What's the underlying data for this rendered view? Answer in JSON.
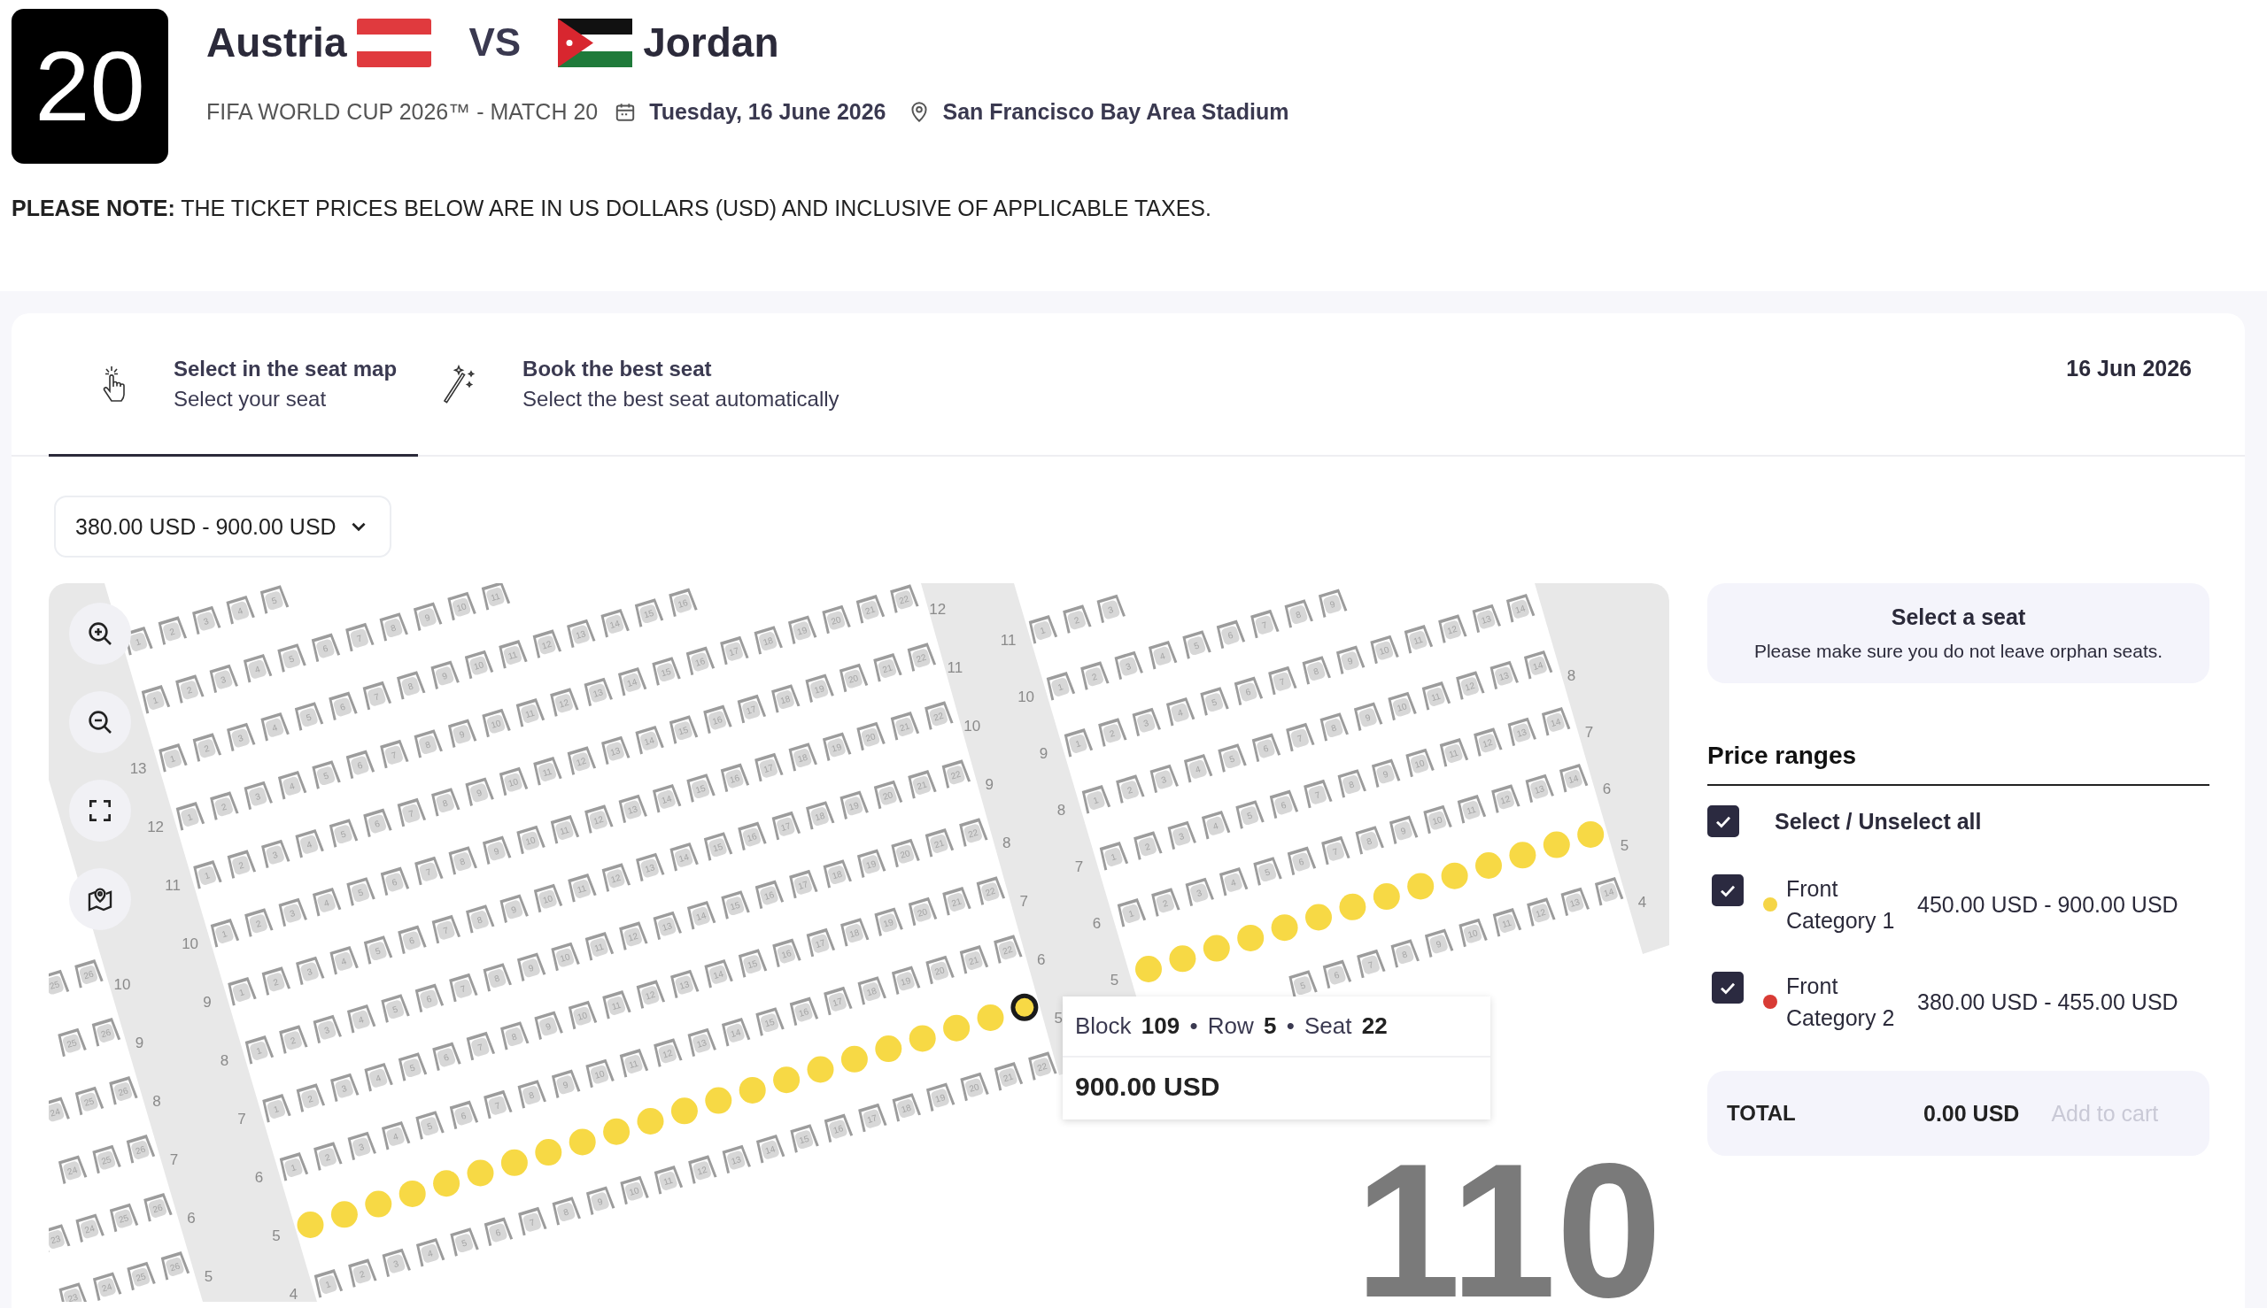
{
  "match": {
    "number": "20",
    "home": "Austria",
    "vs": "VS",
    "away": "Jordan",
    "competition": "FIFA WORLD CUP 2026™ - MATCH 20",
    "date": "Tuesday, 16 June 2026",
    "venue": "San Francisco Bay Area Stadium"
  },
  "notice": "**PLEASE NOTE:** THE TICKET PRICES BELOW ARE IN US DOLLARS (USD) AND INCLUSIVE OF APPLICABLE TAXES.",
  "tabs": [
    {
      "kind": "pointer",
      "title": "Select in the seat map",
      "subtitle": "Select your seat",
      "selected": true
    },
    {
      "kind": "wand",
      "title": "Book the best seat",
      "subtitle": "Select the best seat automatically",
      "selected": false
    }
  ],
  "date": "16 Jun 2026",
  "price_filter": "380.00 USD - 900.00 USD",
  "seat_map": {
    "blocks": [
      {
        "rows": [
          {
            "label_end": "5",
            "kind": "available",
            "cut_at_start": true,
            "seats": [
              "23",
              "24",
              "25",
              "26"
            ]
          },
          {
            "label_end": "6",
            "kind": "available",
            "cut_at_start": true,
            "seats": [
              "23",
              "24",
              "25",
              "26"
            ]
          },
          {
            "label_end": "7",
            "kind": "available",
            "cut_at_start": true,
            "seats": [
              "24",
              "25",
              "26"
            ]
          },
          {
            "label_end": "8",
            "kind": "available",
            "cut_at_start": true,
            "seats": [
              "24",
              "25",
              "26"
            ]
          },
          {
            "label_end": "9",
            "kind": "available",
            "cut_at_start": true,
            "seats": [
              "25",
              "26"
            ]
          },
          {
            "label_end": "10",
            "kind": "available",
            "cut_at_start": true,
            "seats": [
              "25",
              "26"
            ]
          }
        ]
      },
      {
        "rows": [
          {
            "label_start": "4",
            "kind": "available",
            "seats": [
              "1",
              "2",
              "3",
              "4",
              "5",
              "6",
              "7",
              "8",
              "9",
              "10",
              "11",
              "12",
              "13",
              "14",
              "15",
              "16",
              "17",
              "18",
              "19",
              "20",
              "21",
              "22"
            ]
          },
          {
            "label_start": "5",
            "label_end": "5",
            "kind": "priced",
            "color": "#f7d945",
            "seats": [
              {
                "hovered": false
              },
              {
                "hovered": false
              },
              {
                "hovered": false
              },
              {
                "hovered": false
              },
              {
                "hovered": false
              },
              {
                "hovered": false
              },
              {
                "hovered": false
              },
              {
                "hovered": false
              },
              {
                "hovered": false
              },
              {
                "hovered": false
              },
              {
                "hovered": false
              },
              {
                "hovered": false
              },
              {
                "hovered": false
              },
              {
                "hovered": false
              },
              {
                "hovered": false
              },
              {
                "hovered": false
              },
              {
                "hovered": false
              },
              {
                "hovered": false
              },
              {
                "hovered": false
              },
              {
                "hovered": false
              },
              {
                "hovered": false
              },
              {
                "hovered": true
              }
            ]
          },
          {
            "label_start": "6",
            "label_end": "6",
            "kind": "available",
            "seats": [
              "1",
              "2",
              "3",
              "4",
              "5",
              "6",
              "7",
              "8",
              "9",
              "10",
              "11",
              "12",
              "13",
              "14",
              "15",
              "16",
              "17",
              "18",
              "19",
              "20",
              "21",
              "22"
            ]
          },
          {
            "label_start": "7",
            "label_end": "7",
            "kind": "available",
            "seats": [
              "1",
              "2",
              "3",
              "4",
              "5",
              "6",
              "7",
              "8",
              "9",
              "10",
              "11",
              "12",
              "13",
              "14",
              "15",
              "16",
              "17",
              "18",
              "19",
              "20",
              "21",
              "22"
            ]
          },
          {
            "label_start": "8",
            "label_end": "8",
            "kind": "available",
            "seats": [
              "1",
              "2",
              "3",
              "4",
              "5",
              "6",
              "7",
              "8",
              "9",
              "10",
              "11",
              "12",
              "13",
              "14",
              "15",
              "16",
              "17",
              "18",
              "19",
              "20",
              "21",
              "22"
            ]
          },
          {
            "label_start": "9",
            "label_end": "9",
            "kind": "available",
            "seats": [
              "1",
              "2",
              "3",
              "4",
              "5",
              "6",
              "7",
              "8",
              "9",
              "10",
              "11",
              "12",
              "13",
              "14",
              "15",
              "16",
              "17",
              "18",
              "19",
              "20",
              "21",
              "22"
            ]
          },
          {
            "label_start": "10",
            "label_end": "10",
            "kind": "available",
            "seats": [
              "1",
              "2",
              "3",
              "4",
              "5",
              "6",
              "7",
              "8",
              "9",
              "10",
              "11",
              "12",
              "13",
              "14",
              "15",
              "16",
              "17",
              "18",
              "19",
              "20",
              "21",
              "22"
            ]
          },
          {
            "label_start": "11",
            "label_end": "11",
            "kind": "available",
            "seats": [
              "1",
              "2",
              "3",
              "4",
              "5",
              "6",
              "7",
              "8",
              "9",
              "10",
              "11",
              "12",
              "13",
              "14",
              "15",
              "16",
              "17",
              "18",
              "19",
              "20",
              "21",
              "22"
            ]
          },
          {
            "label_start": "12",
            "label_end": "12",
            "kind": "available",
            "seats": [
              "1",
              "2",
              "3",
              "4",
              "5",
              "6",
              "7",
              "8",
              "9",
              "10",
              "11",
              "12",
              "13",
              "14",
              "15",
              "16",
              "17",
              "18",
              "19",
              "20",
              "21",
              "22"
            ]
          },
          {
            "label_start": "13",
            "kind": "available",
            "seats": [
              "1",
              "2",
              "3",
              "4",
              "5",
              "6",
              "7",
              "8",
              "9",
              "10",
              "11",
              "12",
              "13",
              "14",
              "15",
              "16"
            ]
          },
          {
            "kind": "available",
            "seats": [
              "1",
              "2",
              "3",
              "4",
              "5",
              "6",
              "7",
              "8",
              "9",
              "10",
              "11"
            ]
          },
          {
            "kind": "available",
            "seats": [
              "1",
              "2",
              "3",
              "4",
              "5"
            ]
          }
        ]
      },
      {
        "rows": [
          {
            "label_end": "4",
            "kind": "available",
            "cut_at_start": true,
            "seats": [
              "5",
              "6",
              "7",
              "8",
              "9",
              "10",
              "11",
              "12",
              "13",
              "14"
            ]
          },
          {
            "label_start": "5",
            "label_end": "5",
            "kind": "priced",
            "color": "#f7d945",
            "seats": [
              {
                "hovered": false
              },
              {
                "hovered": false
              },
              {
                "hovered": false
              },
              {
                "hovered": false
              },
              {
                "hovered": false
              },
              {
                "hovered": false
              },
              {
                "hovered": false
              },
              {
                "hovered": false
              },
              {
                "hovered": false
              },
              {
                "hovered": false
              },
              {
                "hovered": false
              },
              {
                "hovered": false
              },
              {
                "hovered": false
              },
              {
                "hovered": false
              }
            ]
          },
          {
            "label_start": "6",
            "label_end": "6",
            "kind": "available",
            "seats": [
              "1",
              "2",
              "3",
              "4",
              "5",
              "6",
              "7",
              "8",
              "9",
              "10",
              "11",
              "12",
              "13",
              "14"
            ]
          },
          {
            "label_start": "7",
            "label_end": "7",
            "kind": "available",
            "seats": [
              "1",
              "2",
              "3",
              "4",
              "5",
              "6",
              "7",
              "8",
              "9",
              "10",
              "11",
              "12",
              "13",
              "14"
            ]
          },
          {
            "label_start": "8",
            "label_end": "8",
            "kind": "available",
            "seats": [
              "1",
              "2",
              "3",
              "4",
              "5",
              "6",
              "7",
              "8",
              "9",
              "10",
              "11",
              "12",
              "13",
              "14"
            ]
          },
          {
            "label_start": "9",
            "kind": "available",
            "seats": [
              "1",
              "2",
              "3",
              "4",
              "5",
              "6",
              "7",
              "8",
              "9",
              "10",
              "11",
              "12",
              "13",
              "14"
            ]
          },
          {
            "label_start": "10",
            "kind": "available",
            "seats": [
              "1",
              "2",
              "3",
              "4",
              "5",
              "6",
              "7",
              "8",
              "9"
            ]
          },
          {
            "label_start": "11",
            "kind": "available",
            "seats": [
              "1",
              "2",
              "3"
            ]
          }
        ]
      }
    ],
    "block_label": "110",
    "tooltip": {
      "text": "Block **109** • Row **5** • Seat **22**",
      "price": "900.00 USD"
    }
  },
  "seat_info": {
    "title": "Select a seat",
    "hint": "Please make sure you do not leave orphan seats."
  },
  "price_ranges": {
    "title": "Price ranges",
    "select_all": {
      "label": "Select / Unselect all",
      "checked": true
    },
    "categories": [
      {
        "name": "Front Category 1",
        "color": "#f5d547",
        "range": "450.00 USD - 900.00 USD",
        "checked": true
      },
      {
        "name": "Front Category 2",
        "color": "#d83b35",
        "range": "380.00 USD - 455.00 USD",
        "checked": true
      }
    ]
  },
  "total": {
    "label": "TOTAL",
    "amount": "0.00 USD",
    "button": "Add to cart",
    "disabled": true
  }
}
